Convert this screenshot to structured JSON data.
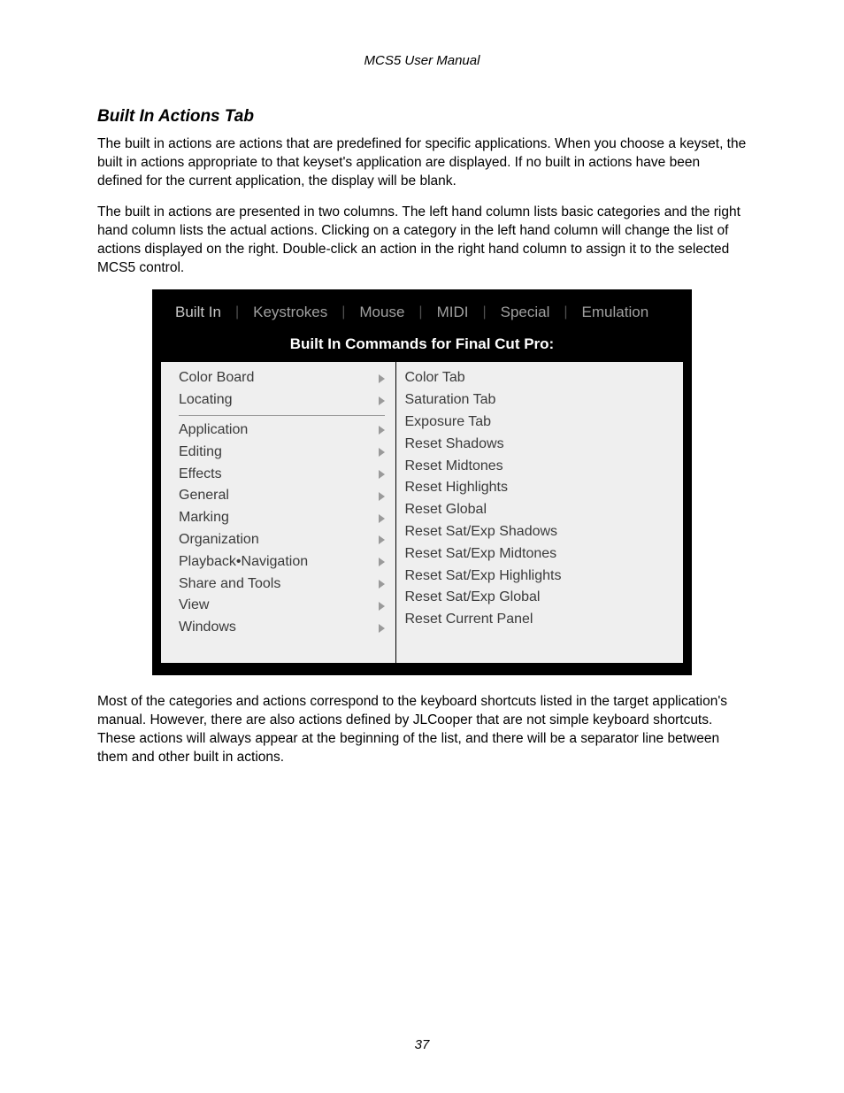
{
  "doc_header": "MCS5 User Manual",
  "section_title": "Built In Actions Tab",
  "para1": "The built in actions are actions that are predefined for specific applications. When you choose a keyset, the built in actions appropriate to that keyset's application are displayed. If no built in actions have been defined for the current application, the display will be blank.",
  "para2": "The built in actions are presented in two columns. The left hand column lists basic categories and the right hand column lists the actual actions. Clicking on a category in the left hand column will change the list of actions displayed on the right. Double-click an action in the right hand column to assign it to the selected MCS5 control.",
  "para3": "Most of the categories and actions correspond to the keyboard shortcuts listed in the target application's manual. However, there are also actions defined by JLCooper that are not simple keyboard shortcuts. These actions will always appear at the beginning of the list, and there will be a separator line between them and other built in actions.",
  "page_number": "37",
  "screenshot": {
    "tabs": [
      "Built In",
      "Keystrokes",
      "Mouse",
      "MIDI",
      "Special",
      "Emulation"
    ],
    "active_tab_index": 0,
    "subtitle": "Built In Commands for Final Cut Pro:",
    "categories_top": [
      "Color Board",
      "Locating"
    ],
    "categories_bottom": [
      "Application",
      "Editing",
      "Effects",
      "General",
      "Marking",
      "Organization",
      "Playback•Navigation",
      "Share and Tools",
      "View",
      "Windows"
    ],
    "actions": [
      "Color Tab",
      "Saturation Tab",
      "Exposure Tab",
      "Reset Shadows",
      "Reset Midtones",
      "Reset Highlights",
      "Reset Global",
      "Reset Sat/Exp Shadows",
      "Reset Sat/Exp Midtones",
      "Reset Sat/Exp Highlights",
      "Reset Sat/Exp Global",
      "Reset Current Panel"
    ]
  }
}
